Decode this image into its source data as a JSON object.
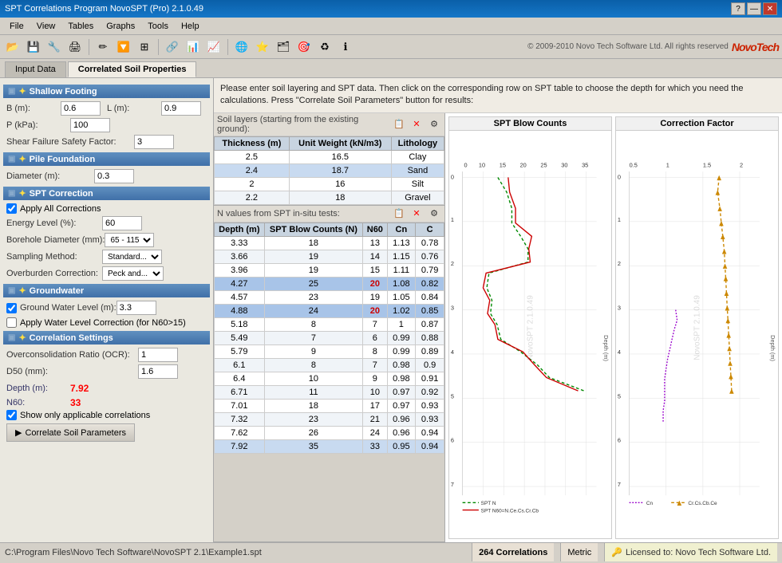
{
  "titleBar": {
    "title": "SPT Correlations Program NovoSPT (Pro) 2.1.0.49",
    "controls": [
      "?",
      "—",
      "✕"
    ]
  },
  "menuBar": {
    "items": [
      "File",
      "View",
      "Tables",
      "Graphs",
      "Tools",
      "Help"
    ]
  },
  "toolbar": {
    "copyright": "© 2009-2010 Novo Tech Software Ltd. All rights reserved",
    "logoText": "NovoTech"
  },
  "tabs": [
    {
      "label": "Input Data",
      "active": false
    },
    {
      "label": "Correlated Soil Properties",
      "active": true
    }
  ],
  "instructionText": "Please enter soil layering and SPT data. Then click on the corresponding row on SPT table to choose the depth for which you need the calculations. Press \"Correlate Soil Parameters\" button for results:",
  "leftPanel": {
    "shallowFooting": {
      "title": "Shallow Footing",
      "B_label": "B (m):",
      "B_value": "0.6",
      "L_label": "L (m):",
      "L_value": "0.9",
      "P_label": "P (kPa):",
      "P_value": "100",
      "safetyFactor_label": "Shear Failure Safety Factor:",
      "safetyFactor_value": "3"
    },
    "pileFoundation": {
      "title": "Pile Foundation",
      "diameter_label": "Diameter (m):",
      "diameter_value": "0.3"
    },
    "sptCorrection": {
      "title": "SPT Correction",
      "applyAll_label": "Apply All Corrections",
      "applyAll_checked": true,
      "energyLevel_label": "Energy Level (%):",
      "energyLevel_value": "60",
      "boreholeDiameter_label": "Borehole Diameter (mm):",
      "boreholeDiameter_value": "65 - 115",
      "samplingMethod_label": "Sampling Method:",
      "samplingMethod_value": "Standard...",
      "overburden_label": "Overburden Correction:",
      "overburden_value": "Peck and..."
    },
    "groundwater": {
      "title": "Groundwater",
      "gwLevel_label": "Ground Water Level (m):",
      "gwLevel_value": "3.3",
      "gwLevel_checked": true,
      "waterCorrection_label": "Apply Water Level Correction (for N60>15)",
      "waterCorrection_checked": false
    },
    "correlationSettings": {
      "title": "Correlation Settings",
      "ocr_label": "Overconsolidation Ratio (OCR):",
      "ocr_value": "1",
      "d50_label": "D50 (mm):",
      "d50_value": "1.6"
    },
    "depth_label": "Depth (m):",
    "depth_value": "7.92",
    "n60_label": "N60:",
    "n60_value": "33",
    "showOnlyApplicable_label": "Show only applicable correlations",
    "showOnlyApplicable_checked": true,
    "correlateButton": "Correlate Soil Parameters"
  },
  "soilLayersTable": {
    "toolbarLabel": "Soil layers (starting from the existing ground):",
    "columns": [
      "Thickness (m)",
      "Unit Weight (kN/m3)",
      "Lithology"
    ],
    "rows": [
      {
        "thickness": "2.5",
        "unitWeight": "16.5",
        "lithology": "Clay"
      },
      {
        "thickness": "2.4",
        "unitWeight": "18.7",
        "lithology": "Sand",
        "selected": true
      },
      {
        "thickness": "2",
        "unitWeight": "16",
        "lithology": "Silt"
      },
      {
        "thickness": "2.2",
        "unitWeight": "18",
        "lithology": "Gravel"
      }
    ]
  },
  "sptTable": {
    "toolbarLabel": "N values from SPT in-situ tests:",
    "columns": [
      "Depth (m)",
      "SPT Blow Counts (N)",
      "N60",
      "Cn",
      "C"
    ],
    "rows": [
      {
        "depth": "3.33",
        "n": "18",
        "n60": "13",
        "cn": "1.13",
        "c": "0.78"
      },
      {
        "depth": "3.66",
        "n": "19",
        "n60": "14",
        "cn": "1.15",
        "c": "0.76"
      },
      {
        "depth": "3.96",
        "n": "19",
        "n60": "15",
        "cn": "1.11",
        "c": "0.79"
      },
      {
        "depth": "4.27",
        "n": "25",
        "n60": "20",
        "cn": "1.08",
        "c": "0.82",
        "highlighted": true
      },
      {
        "depth": "4.57",
        "n": "23",
        "n60": "19",
        "cn": "1.05",
        "c": "0.84"
      },
      {
        "depth": "4.88",
        "n": "24",
        "n60": "20",
        "cn": "1.02",
        "c": "0.85",
        "highlighted": true
      },
      {
        "depth": "5.18",
        "n": "8",
        "n60": "7",
        "cn": "1",
        "c": "0.87"
      },
      {
        "depth": "5.49",
        "n": "7",
        "n60": "6",
        "cn": "0.99",
        "c": "0.88"
      },
      {
        "depth": "5.79",
        "n": "9",
        "n60": "8",
        "cn": "0.99",
        "c": "0.89"
      },
      {
        "depth": "6.1",
        "n": "8",
        "n60": "7",
        "cn": "0.98",
        "c": "0.9"
      },
      {
        "depth": "6.4",
        "n": "10",
        "n60": "9",
        "cn": "0.98",
        "c": "0.91"
      },
      {
        "depth": "6.71",
        "n": "11",
        "n60": "10",
        "cn": "0.97",
        "c": "0.92"
      },
      {
        "depth": "7.01",
        "n": "18",
        "n60": "17",
        "cn": "0.97",
        "c": "0.93"
      },
      {
        "depth": "7.32",
        "n": "23",
        "n60": "21",
        "cn": "0.96",
        "c": "0.93"
      },
      {
        "depth": "7.62",
        "n": "26",
        "n60": "24",
        "cn": "0.96",
        "c": "0.94"
      },
      {
        "depth": "7.92",
        "n": "35",
        "n60": "33",
        "cn": "0.95",
        "c": "0.94",
        "selected": true
      }
    ]
  },
  "charts": {
    "sptChart": {
      "title": "SPT Blow Counts",
      "xLabel": "0  10  15  20  25  30  35",
      "legend": [
        {
          "label": "SPT N",
          "color": "#008800",
          "style": "dashed"
        },
        {
          "label": "SPT N60=N.Ce.Cs.Cr.Cb",
          "color": "#cc0000",
          "style": "solid"
        }
      ]
    },
    "correctionChart": {
      "title": "Correction Factor",
      "xLabel": "0.5   1   1.5   2",
      "legend": [
        {
          "label": "Cn",
          "color": "#9900cc",
          "style": "dotted"
        },
        {
          "label": "Cr.Cs.Cb.Ce",
          "color": "#cc8800",
          "style": "dashed-triangle"
        }
      ]
    }
  },
  "statusBar": {
    "path": "C:\\Program Files\\Novo Tech Software\\NovoSPT 2.1\\Example1.spt",
    "correlations": "264 Correlations",
    "metric": "Metric",
    "license": "Licensed to: Novo Tech Software Ltd."
  }
}
